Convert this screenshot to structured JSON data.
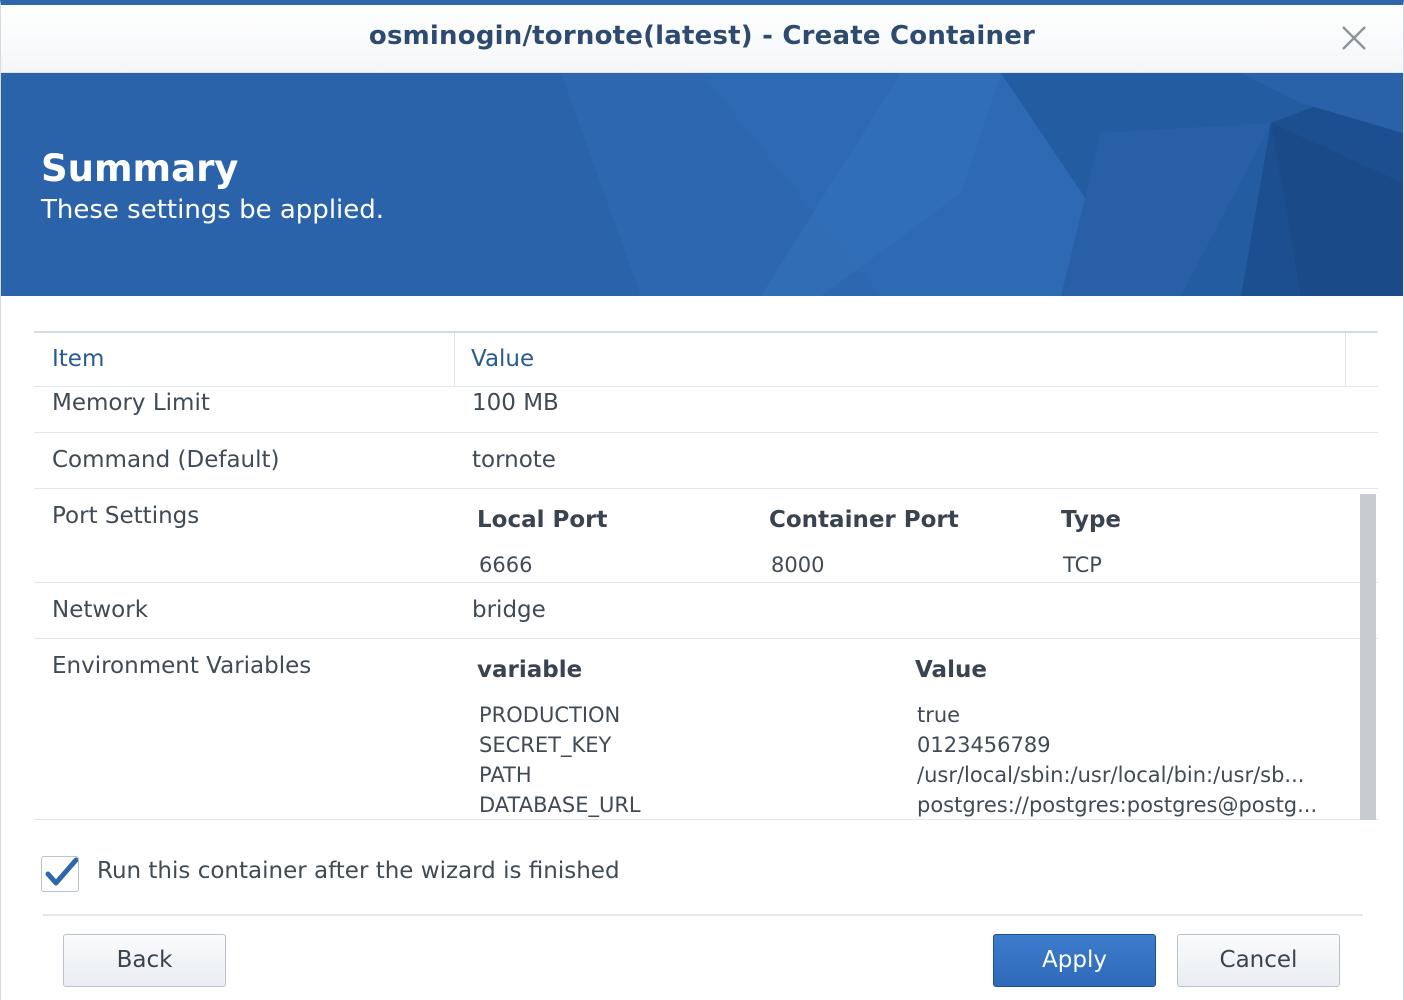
{
  "window": {
    "title": "osminogin/tornote(latest) - Create Container"
  },
  "banner": {
    "title": "Summary",
    "subtitle": "These settings be applied."
  },
  "table": {
    "headers": [
      "Item",
      "Value"
    ],
    "rows": {
      "memory_limit": {
        "item": "Memory Limit",
        "value": "100 MB"
      },
      "command": {
        "item": "Command (Default)",
        "value": "tornote"
      },
      "port_settings": {
        "item": "Port Settings",
        "headers": [
          "Local Port",
          "Container Port",
          "Type"
        ],
        "entries": [
          {
            "local_port": "6666",
            "container_port": "8000",
            "type": "TCP"
          }
        ]
      },
      "network": {
        "item": "Network",
        "value": "bridge"
      },
      "env": {
        "item": "Environment Variables",
        "headers": [
          "variable",
          "Value"
        ],
        "entries": [
          {
            "variable": "PRODUCTION",
            "value": "true"
          },
          {
            "variable": "SECRET_KEY",
            "value": "0123456789"
          },
          {
            "variable": "PATH",
            "value": "/usr/local/sbin:/usr/local/bin:/usr/sb..."
          },
          {
            "variable": "DATABASE_URL",
            "value": "postgres://postgres:postgres@postg..."
          }
        ]
      }
    }
  },
  "run_after": {
    "label": "Run this container after the wizard is finished",
    "checked": true
  },
  "buttons": {
    "back": "Back",
    "apply": "Apply",
    "cancel": "Cancel"
  },
  "icons": {
    "close": "close-icon",
    "check": "checkmark-icon"
  },
  "colors": {
    "accent": "#2f67ad",
    "title_text": "#2e4a6e",
    "header_text": "#2a5a92"
  }
}
